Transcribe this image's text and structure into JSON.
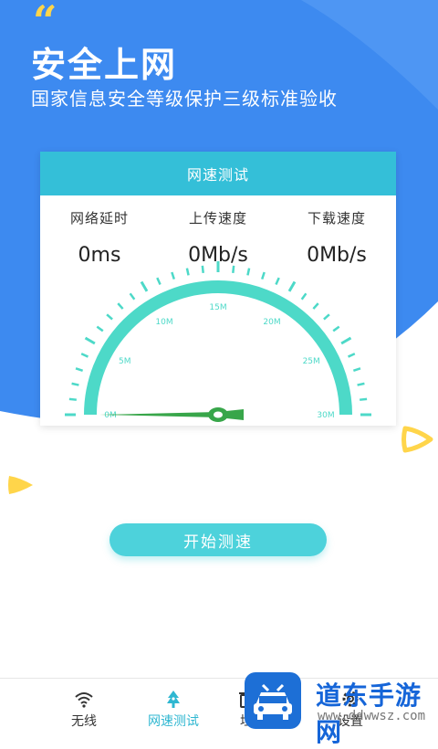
{
  "hero": {
    "title": "安全上网",
    "subtitle": "国家信息安全等级保护三级标准验收",
    "quote_icon": "“"
  },
  "card": {
    "header": "网速测试",
    "stats": [
      {
        "label": "网络延时",
        "value": "0ms"
      },
      {
        "label": "上传速度",
        "value": "0Mb/s"
      },
      {
        "label": "下载速度",
        "value": "0Mb/s"
      }
    ]
  },
  "gauge": {
    "scale_labels": [
      "0M",
      "5M",
      "10M",
      "15M",
      "20M",
      "25M",
      "30M"
    ],
    "current_value": 0,
    "max": 30,
    "color": "#4DD9C8"
  },
  "start_button": {
    "label": "开始测速"
  },
  "tabbar": {
    "items": [
      {
        "label": "无线",
        "icon": "wifi-icon"
      },
      {
        "label": "网速测试",
        "icon": "speedtest-icon"
      },
      {
        "label": "垃",
        "icon": "clean-icon"
      },
      {
        "label": "设置",
        "icon": "gear-icon"
      }
    ]
  },
  "watermark": {
    "text": "道东手游网",
    "url": "www.ddwwsz.com"
  },
  "colors": {
    "hero_blue": "#3D8AF0",
    "accent": "#34BFD8",
    "button": "#4DD2DB",
    "yellow": "#FFD54A"
  }
}
